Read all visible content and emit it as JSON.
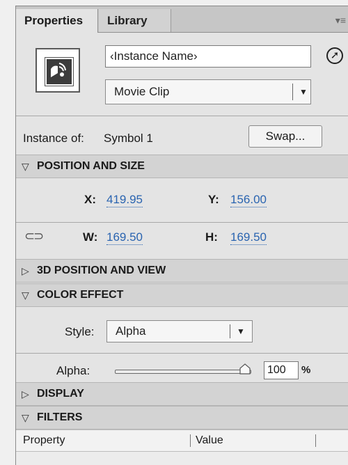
{
  "tabs": [
    {
      "label": "Properties",
      "active": true
    },
    {
      "label": "Library",
      "active": false
    }
  ],
  "panel_menu_icon": "panel-menu-icon",
  "instance": {
    "name_value": "‹Instance Name›",
    "type_value": "Movie Clip",
    "instance_of_label": "Instance of:",
    "symbol_name": "Symbol 1",
    "swap_label": "Swap..."
  },
  "sections": {
    "position_size": "POSITION AND SIZE",
    "three_d": "3D POSITION AND VIEW",
    "color_effect": "COLOR EFFECT",
    "display": "DISPLAY",
    "filters": "FILTERS"
  },
  "position": {
    "x_label": "X:",
    "x_value": "419.95",
    "y_label": "Y:",
    "y_value": "156.00",
    "w_label": "W:",
    "w_value": "169.50",
    "h_label": "H:",
    "h_value": "169.50"
  },
  "color_effect": {
    "style_label": "Style:",
    "style_value": "Alpha",
    "alpha_label": "Alpha:",
    "alpha_value": "100",
    "alpha_unit": "%",
    "alpha_level": 1.0
  },
  "filters_table": {
    "col_property": "Property",
    "col_value": "Value"
  },
  "colors": {
    "link_value": "#2a64b0",
    "section_bg": "#d3d3d3",
    "panel_bg": "#e4e4e4"
  }
}
